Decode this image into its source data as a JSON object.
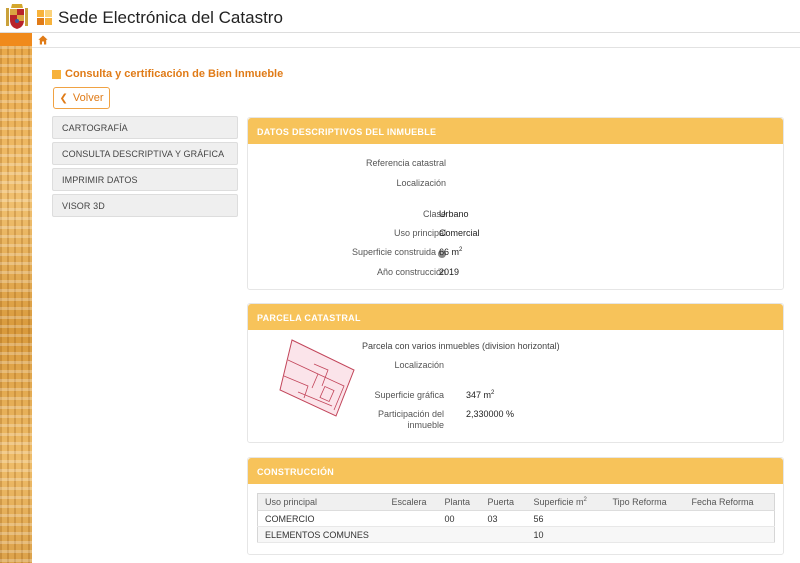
{
  "header": {
    "site_title": "Sede Electrónica del Catastro"
  },
  "page": {
    "title": "Consulta y certificación de Bien Inmueble",
    "back_label": "Volver"
  },
  "sidebar": {
    "items": [
      {
        "label": "CARTOGRAFÍA"
      },
      {
        "label": "CONSULTA DESCRIPTIVA Y GRÁFICA"
      },
      {
        "label": "IMPRIMIR DATOS"
      },
      {
        "label": "VISOR 3D"
      }
    ]
  },
  "descriptive": {
    "title": "DATOS DESCRIPTIVOS DEL INMUEBLE",
    "ref_label": "Referencia catastral",
    "loc_label": "Localización",
    "clase_label": "Clase",
    "clase_value": "Urbano",
    "uso_label": "Uso principal",
    "uso_value": "Comercial",
    "sup_label": "Superficie construida",
    "sup_value": "66 m",
    "sup_exp": "2",
    "anio_label": "Año construcción",
    "anio_value": "2019"
  },
  "parcela": {
    "title": "PARCELA CATASTRAL",
    "subtitle": "Parcela con varios inmuebles (division horizontal)",
    "loc_label": "Localización",
    "sup_label": "Superficie gráfica",
    "sup_value": "347 m",
    "sup_exp": "2",
    "part_label_1": "Participación del",
    "part_label_2": "inmueble",
    "part_value": "2,330000 %"
  },
  "construccion": {
    "title": "CONSTRUCCIÓN",
    "columns": [
      "Uso principal",
      "Escalera",
      "Planta",
      "Puerta",
      "Superficie m",
      "Tipo Reforma",
      "Fecha Reforma"
    ],
    "sup_col_exp": "2",
    "rows": [
      [
        "COMERCIO",
        "",
        "00",
        "03",
        "56",
        "",
        ""
      ],
      [
        "ELEMENTOS COMUNES",
        "",
        "",
        "",
        "10",
        "",
        ""
      ]
    ]
  },
  "colors": {
    "accent": "#f7c35a",
    "title_orange": "#e07b17"
  },
  "icons": {
    "home": "home-icon",
    "back": "chevron-left-icon",
    "info": "info-icon",
    "coat": "coat-of-arms-icon"
  }
}
